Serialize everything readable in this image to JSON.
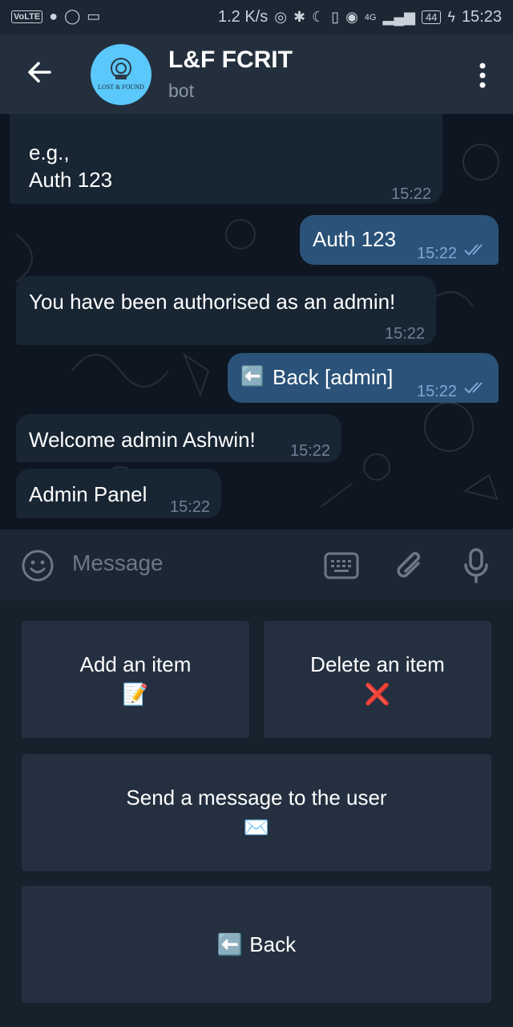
{
  "status_bar": {
    "volte": "VoLTE",
    "speed": "1.2 K/s",
    "network": "4G",
    "battery": "44",
    "time": "15:23"
  },
  "header": {
    "title": "L&F FCRIT",
    "subtitle": "bot",
    "avatar_text": "Lost & Found"
  },
  "messages": [
    {
      "dir": "in",
      "text_line1": "e.g.,",
      "text_line2": "Auth 123",
      "time": "15:22"
    },
    {
      "dir": "out",
      "text": "Auth 123",
      "time": "15:22"
    },
    {
      "dir": "in",
      "text": "You have been authorised as an admin!",
      "time": "15:22"
    },
    {
      "dir": "out",
      "emoji": "⬅️",
      "text": "Back [admin]",
      "time": "15:22"
    },
    {
      "dir": "in",
      "text": "Welcome admin Ashwin!",
      "time": "15:22"
    },
    {
      "dir": "in",
      "text": "Admin Panel",
      "time": "15:22"
    }
  ],
  "input": {
    "placeholder": "Message"
  },
  "keyboard": {
    "buttons": [
      {
        "label": "Add an item",
        "emoji": "📝"
      },
      {
        "label": "Delete an item",
        "emoji": "❌"
      },
      {
        "label": "Send a message to the user",
        "emoji": "✉️"
      },
      {
        "label": "Back",
        "emoji": "⬅️"
      }
    ]
  },
  "colors": {
    "header_bg": "#242f3d",
    "chat_bg": "#0e1621",
    "incoming_bubble": "#182533",
    "outgoing_bubble": "#2b5278",
    "keyboard_bg": "#17212b",
    "key_bg": "#243040"
  }
}
